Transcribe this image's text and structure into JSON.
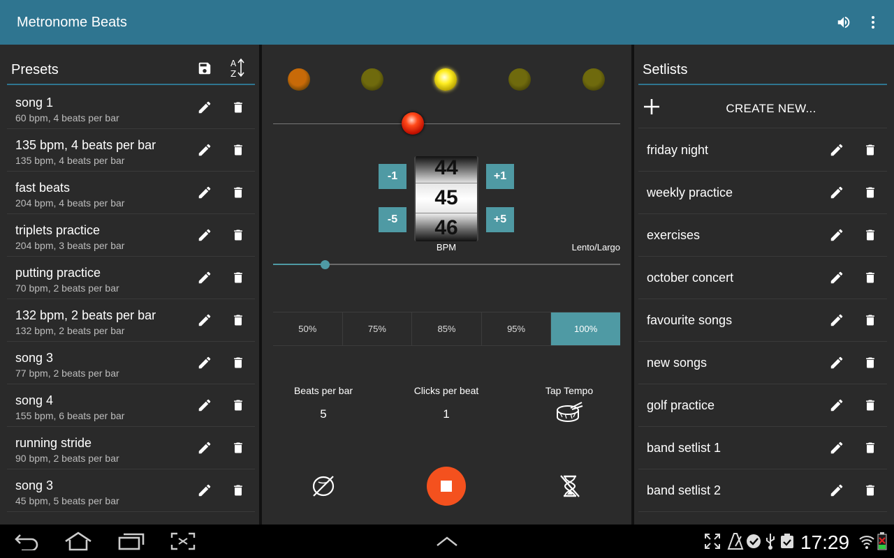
{
  "app": {
    "title": "Metronome Beats"
  },
  "presets": {
    "title": "Presets",
    "items": [
      {
        "title": "song 1",
        "subtitle": "60 bpm, 4 beats per bar"
      },
      {
        "title": "135 bpm, 4 beats per bar",
        "subtitle": "135 bpm, 4 beats per bar"
      },
      {
        "title": "fast beats",
        "subtitle": "204 bpm, 4 beats per bar"
      },
      {
        "title": "triplets practice",
        "subtitle": "204 bpm, 3 beats per bar"
      },
      {
        "title": "putting practice",
        "subtitle": "70 bpm, 2 beats per bar"
      },
      {
        "title": "132 bpm, 2 beats per bar",
        "subtitle": "132 bpm, 2 beats per bar"
      },
      {
        "title": "song 3",
        "subtitle": "77 bpm, 2 beats per bar"
      },
      {
        "title": "song 4",
        "subtitle": "155 bpm, 6 beats per bar"
      },
      {
        "title": "running stride",
        "subtitle": "90 bpm, 2 beats per bar"
      },
      {
        "title": "song 3",
        "subtitle": "45 bpm, 5 beats per bar"
      }
    ]
  },
  "metronome": {
    "beat_lights": [
      {
        "state": "accent-dim",
        "color": "#c86a08"
      },
      {
        "state": "dim",
        "color": "#6f6a0d"
      },
      {
        "state": "active",
        "color": "#ffee22"
      },
      {
        "state": "dim",
        "color": "#6f6a0d"
      },
      {
        "state": "dim",
        "color": "#6f6a0d"
      }
    ],
    "steppers": {
      "minus1": "-1",
      "plus1": "+1",
      "minus5": "-5",
      "plus5": "+5"
    },
    "bpm_wheel": {
      "prev": "44",
      "current": "45",
      "next": "46"
    },
    "bpm_label": "BPM",
    "tempo_name": "Lento/Largo",
    "tempo_slider_fraction": 0.148,
    "percent_options": [
      "50%",
      "75%",
      "85%",
      "95%",
      "100%"
    ],
    "percent_selected": "100%",
    "beats_per_bar": {
      "label": "Beats per bar",
      "value": "5"
    },
    "clicks_per_beat": {
      "label": "Clicks per beat",
      "value": "1"
    },
    "tap_tempo": {
      "label": "Tap Tempo"
    },
    "accent_color": "#4f9aa4",
    "stop_color": "#f4511e"
  },
  "setlists": {
    "title": "Setlists",
    "create_label": "CREATE NEW...",
    "items": [
      "friday night",
      "weekly practice",
      "exercises",
      "october concert",
      "favourite songs",
      "new songs",
      "golf practice",
      "band setlist 1",
      "band setlist 2"
    ]
  },
  "system": {
    "clock": "17:29"
  },
  "colors": {
    "actionbar": "#2f7590",
    "panel": "#2a2a2a"
  }
}
